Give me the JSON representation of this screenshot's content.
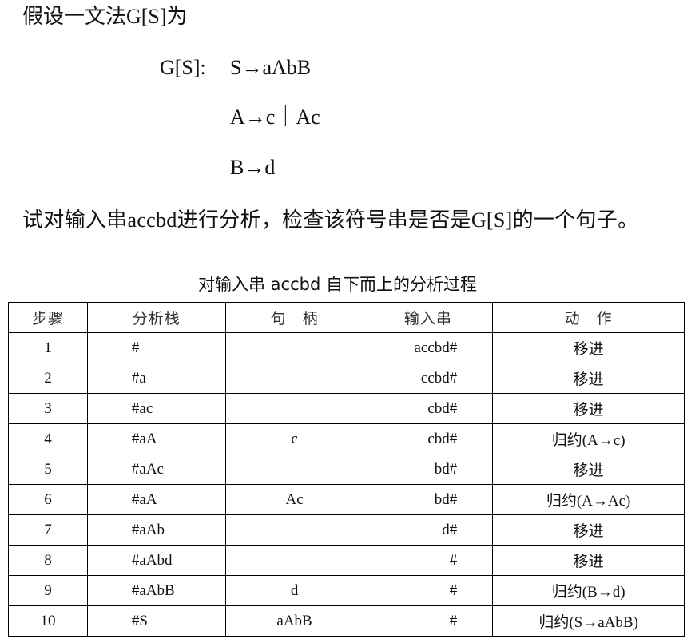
{
  "intro": "假设一文法G[S]为",
  "grammar": {
    "label": "G[S]:",
    "rules": [
      "S→aAbB",
      "A→c｜Ac",
      "B→d"
    ]
  },
  "question": "试对输入串accbd进行分析，检查该符号串是否是G[S]的一个句子。",
  "table": {
    "caption": "对输入串 accbd 自下而上的分析过程",
    "headers": [
      "步骤",
      "分析栈",
      "句　柄",
      "输入串",
      "动　作"
    ],
    "rows": [
      {
        "step": "1",
        "stack": "#",
        "handle": "",
        "input": "accbd#",
        "action": "移进"
      },
      {
        "step": "2",
        "stack": "#a",
        "handle": "",
        "input": "ccbd#",
        "action": "移进"
      },
      {
        "step": "3",
        "stack": "#ac",
        "handle": "",
        "input": "cbd#",
        "action": "移进"
      },
      {
        "step": "4",
        "stack": "#aA",
        "handle": "c",
        "input": "cbd#",
        "action": "归约(A→c)"
      },
      {
        "step": "5",
        "stack": "#aAc",
        "handle": "",
        "input": "bd#",
        "action": "移进"
      },
      {
        "step": "6",
        "stack": "#aA",
        "handle": "Ac",
        "input": "bd#",
        "action": "归约(A→Ac)"
      },
      {
        "step": "7",
        "stack": "#aAb",
        "handle": "",
        "input": "d#",
        "action": "移进"
      },
      {
        "step": "8",
        "stack": "#aAbd",
        "handle": "",
        "input": "#",
        "action": "移进"
      },
      {
        "step": "9",
        "stack": "#aAbB",
        "handle": "d",
        "input": "#",
        "action": "归约(B→d)"
      },
      {
        "step": "10",
        "stack": "#S",
        "handle": "aAbB",
        "input": "#",
        "action": "归约(S→aAbB)"
      }
    ]
  }
}
